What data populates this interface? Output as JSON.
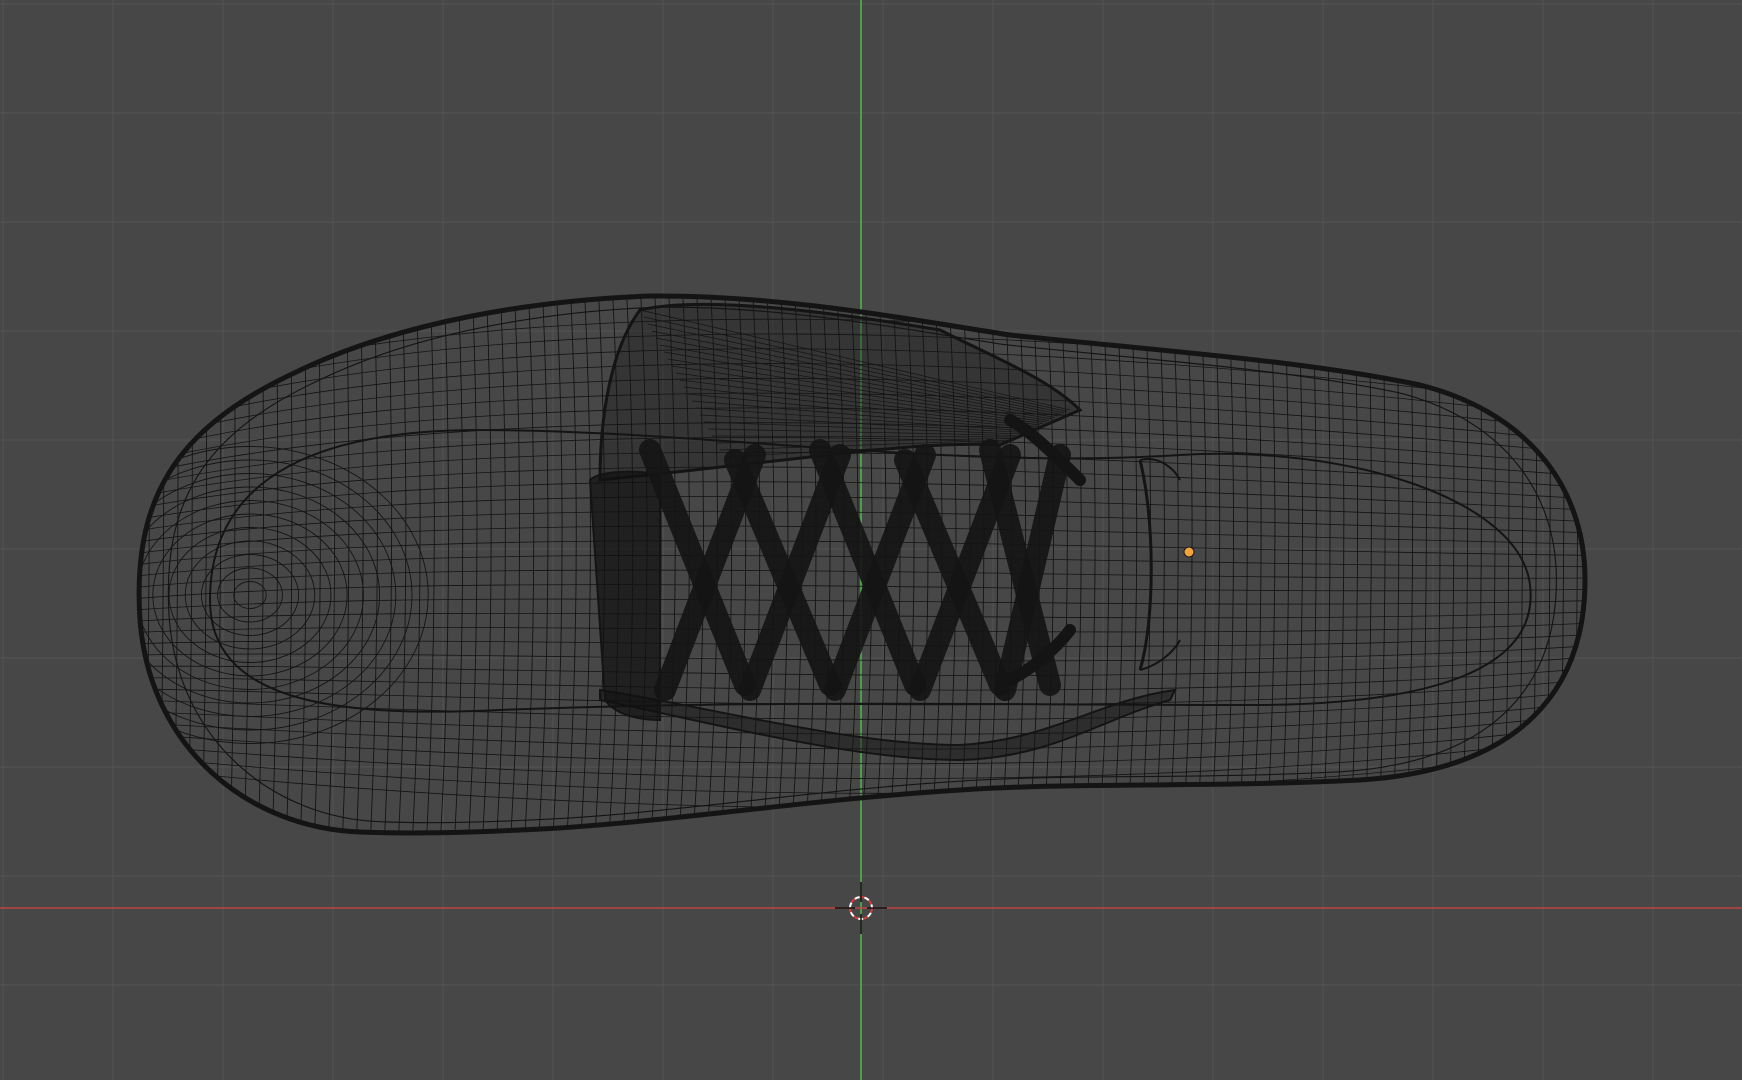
{
  "viewport": {
    "view": "top-orthographic",
    "display_mode": "wireframe",
    "background_color": "#474747",
    "grid_line_color": "#535353",
    "x_axis_color": "#c24444",
    "y_axis_color": "#52b84d",
    "wire_color": "#141414",
    "origin_color": "#f2a33a",
    "cursor_color_a": "#d93a3a",
    "cursor_color_b": "#ffffff",
    "object": {
      "type": "shoe-mesh",
      "selected": false
    }
  }
}
